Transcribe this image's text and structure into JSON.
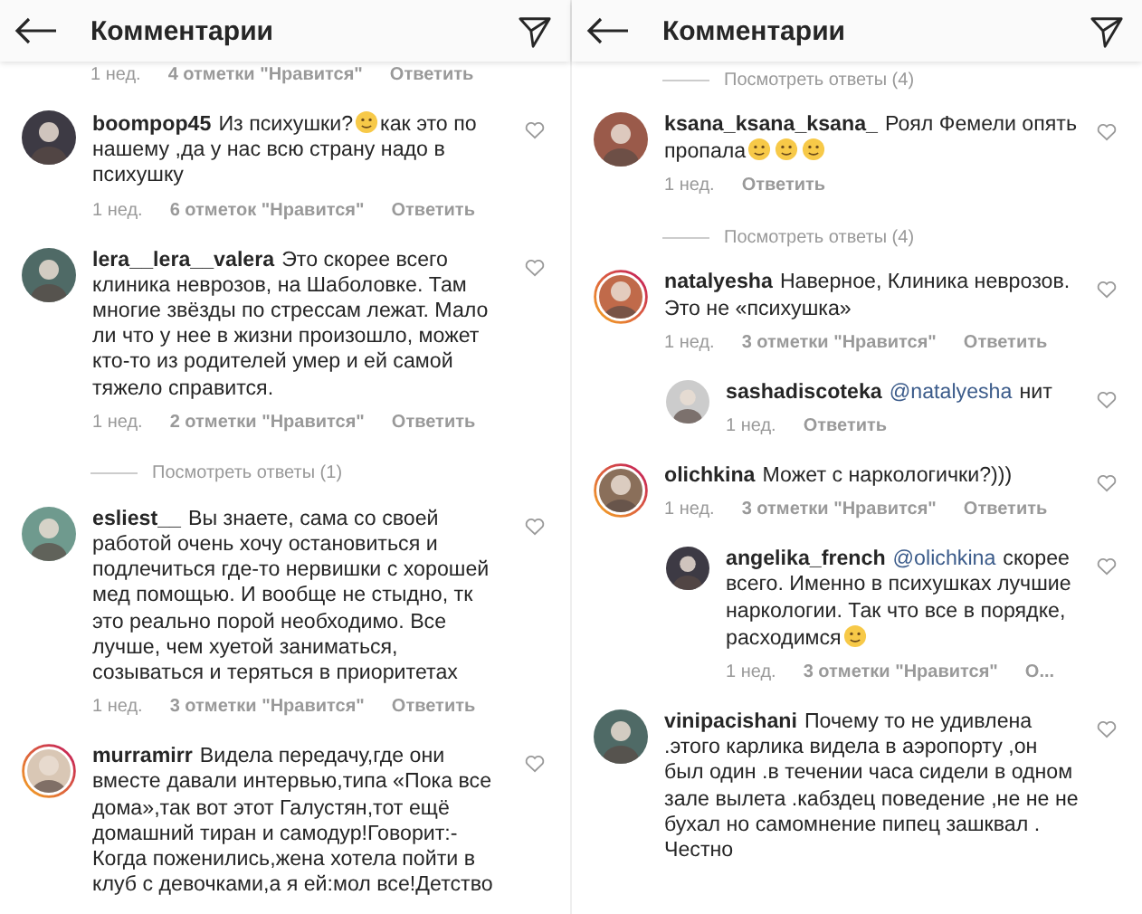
{
  "panels": [
    {
      "header": {
        "title": "Комментарии"
      },
      "items": [
        {
          "kind": "meta",
          "meta": {
            "time": "1 нед.",
            "likes": "4 отметки \"Нравится\"",
            "reply": "Ответить"
          }
        },
        {
          "kind": "comment",
          "user": "boompop45",
          "story_ring": false,
          "reply": false,
          "body": [
            {
              "kind": "text",
              "text": "Из психушки?"
            },
            {
              "kind": "emoji"
            },
            {
              "kind": "text",
              "text": "как это по нашему ,да у нас всю страну надо в психушку"
            }
          ],
          "meta": {
            "time": "1 нед.",
            "likes": "6 отметок \"Нравится\"",
            "reply": "Ответить"
          }
        },
        {
          "kind": "comment",
          "user": "lera__lera__valera",
          "story_ring": false,
          "reply": false,
          "body": [
            {
              "kind": "text",
              "text": "Это скорее всего клиника неврозов, на Шаболовке. Там многие звёзды по стрессам лежат. Мало ли что у нее в жизни произошло, может кто-то из родителей умер и ей самой тяжело справится."
            }
          ],
          "meta": {
            "time": "1 нед.",
            "likes": "2 отметки \"Нравится\"",
            "reply": "Ответить"
          }
        },
        {
          "kind": "replies",
          "text": "Посмотреть ответы (1)"
        },
        {
          "kind": "comment",
          "user": "esliest__",
          "story_ring": false,
          "reply": false,
          "body": [
            {
              "kind": "text",
              "text": "Вы знаете, сама со своей работой очень хочу остановиться и подлечиться где-то нервишки с хорошей мед помощью. И вообще не стыдно, тк это реально порой необходимо. Все лучше, чем хуетой заниматься, созываться и теряться в приоритетах"
            }
          ],
          "meta": {
            "time": "1 нед.",
            "likes": "3 отметки \"Нравится\"",
            "reply": "Ответить"
          }
        },
        {
          "kind": "comment",
          "user": "murramirr",
          "story_ring": true,
          "reply": false,
          "body": [
            {
              "kind": "text",
              "text": "Видела передачу,где они вместе давали интервью,типа «Пока все дома»,так вот этот Галустян,тот ещё домашний тиран и самодур!Говорит:- Когда поженились,жена хотела пойти в клуб с девочками,а я ей:мол все!Детство"
            }
          ]
        }
      ]
    },
    {
      "header": {
        "title": "Комментарии"
      },
      "items": [
        {
          "kind": "replies",
          "text": "Посмотреть ответы (4)"
        },
        {
          "kind": "comment",
          "user": "ksana_ksana_ksana_",
          "story_ring": false,
          "reply": false,
          "body": [
            {
              "kind": "text",
              "text": "Роял Фемели опять пропала"
            },
            {
              "kind": "emoji"
            },
            {
              "kind": "emoji"
            },
            {
              "kind": "emoji"
            }
          ],
          "meta": {
            "time": "1 нед.",
            "reply": "Ответить"
          }
        },
        {
          "kind": "replies",
          "text": "Посмотреть ответы (4)"
        },
        {
          "kind": "comment",
          "user": "natalуesha",
          "story_ring": true,
          "reply": false,
          "body": [
            {
              "kind": "text",
              "text": "Наверное, Клиника неврозов. Это не «психушка»"
            }
          ],
          "meta": {
            "time": "1 нед.",
            "likes": "3 отметки \"Нравится\"",
            "reply": "Ответить"
          }
        },
        {
          "kind": "comment",
          "user": "sashadiscoteka",
          "story_ring": false,
          "reply": true,
          "body": [
            {
              "kind": "mention",
              "text": "@natalуesha"
            },
            {
              "kind": "text",
              "text": "нит"
            }
          ],
          "meta": {
            "time": "1 нед.",
            "reply": "Ответить"
          }
        },
        {
          "kind": "comment",
          "user": "olichkina",
          "story_ring": true,
          "reply": false,
          "body": [
            {
              "kind": "text",
              "text": "Может с наркологички?)))"
            }
          ],
          "meta": {
            "time": "1 нед.",
            "likes": "3 отметки \"Нравится\"",
            "reply": "Ответить"
          }
        },
        {
          "kind": "comment",
          "user": "angelika_french",
          "story_ring": false,
          "reply": true,
          "body": [
            {
              "kind": "mention",
              "text": "@olichkina"
            },
            {
              "kind": "text",
              "text": "скорее всего. Именно в психушках лучшие наркологии. Так что все в порядке, расходимся"
            },
            {
              "kind": "emoji"
            }
          ],
          "meta": {
            "time": "1 нед.",
            "likes": "3 отметки \"Нравится\"",
            "reply": "О..."
          }
        },
        {
          "kind": "comment",
          "user": "vinipacishani",
          "story_ring": false,
          "reply": false,
          "body": [
            {
              "kind": "text",
              "text": "Почему то не удивлена .этого карлика видела в аэропорту ,он был один .в течении часа сидели в одном зале вылета .кабздец поведение ,не не не бухал но самомнение пипец зашквал . Честно"
            }
          ]
        }
      ]
    }
  ]
}
